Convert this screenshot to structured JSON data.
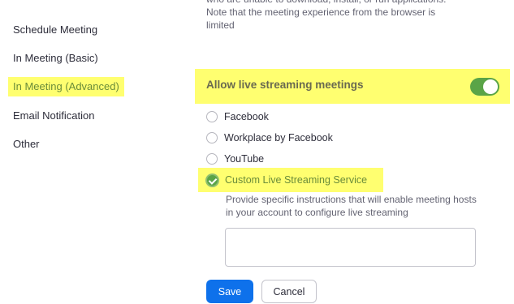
{
  "sidebar": {
    "items": [
      {
        "label": "Schedule Meeting",
        "active": false
      },
      {
        "label": "In Meeting (Basic)",
        "active": false
      },
      {
        "label": "In Meeting (Advanced)",
        "active": true
      },
      {
        "label": "Email Notification",
        "active": false
      },
      {
        "label": "Other",
        "active": false
      }
    ]
  },
  "main": {
    "top_text": "who are unable to download, install, or run applications. Note that the meeting experience from the browser is limited",
    "live_streaming": {
      "label": "Allow live streaming meetings",
      "enabled": true
    },
    "options": [
      {
        "label": "Facebook",
        "checked": false
      },
      {
        "label": "Workplace by Facebook",
        "checked": false
      },
      {
        "label": "YouTube",
        "checked": false
      },
      {
        "label": "Custom Live Streaming Service",
        "checked": true
      }
    ],
    "instructions": "Provide specific instructions that will enable meeting hosts in your account to configure live streaming",
    "textarea_value": "",
    "save_label": "Save",
    "cancel_label": "Cancel"
  },
  "colors": {
    "highlight": "#ffff70",
    "toggle_on": "#5aa447",
    "primary_button": "#0e71eb",
    "active_text": "#6a8c3a"
  }
}
